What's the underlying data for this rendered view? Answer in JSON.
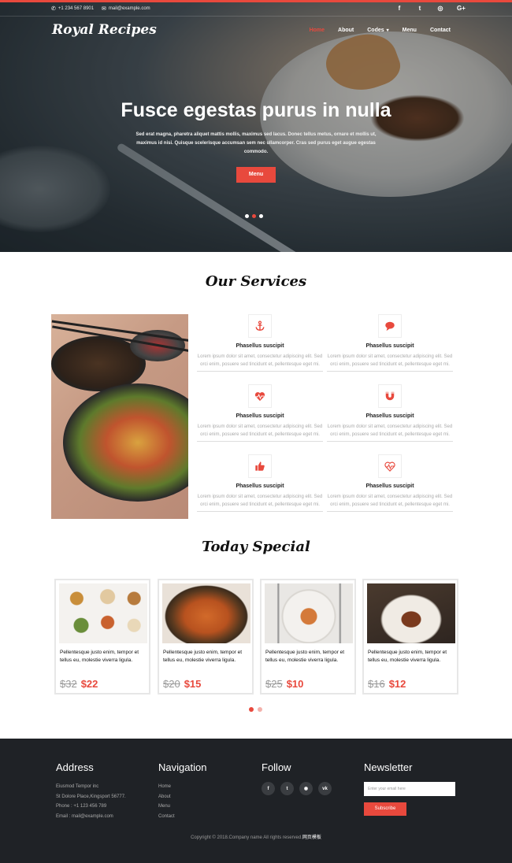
{
  "colors": {
    "accent": "#e8493d",
    "footer_bg": "#1f2226"
  },
  "topbar": {
    "phone": "+1 234 567 8901",
    "email": "mail@example.com",
    "social_icons": [
      "facebook-icon",
      "twitter-icon",
      "dribbble-icon",
      "google-plus-icon"
    ]
  },
  "header": {
    "logo": "Royal Recipes",
    "nav": [
      {
        "label": "Home",
        "active": true
      },
      {
        "label": "About"
      },
      {
        "label": "Codes",
        "dropdown": true
      },
      {
        "label": "Menu"
      },
      {
        "label": "Contact"
      }
    ]
  },
  "hero": {
    "title": "Fusce egestas purus in nulla",
    "text": "Sed erat magna, pharetra aliquet mattis mollis, maximus sed lacus. Donec tellus metus, ornare et mollis ut, maximus id nisi. Quisque scelerisque accumsan sem nec ullamcorper. Cras sed purus eget augue egestas commodo.",
    "button": "Menu"
  },
  "services": {
    "title": "Our Services",
    "items": [
      {
        "icon": "anchor-icon",
        "title": "Phasellus suscipit",
        "text": "Lorem ipsum dolor sit amet, consectetur adipiscing elit. Sed orci enim, posuere sed tincidunt et, pellentesque eget mi."
      },
      {
        "icon": "chat-icon",
        "title": "Phasellus suscipit",
        "text": "Lorem ipsum dolor sit amet, consectetur adipiscing elit. Sed orci enim, posuere sed tincidunt et, pellentesque eget mi."
      },
      {
        "icon": "heartbeat-icon",
        "title": "Phasellus suscipit",
        "text": "Lorem ipsum dolor sit amet, consectetur adipiscing elit. Sed orci enim, posuere sed tincidunt et, pellentesque eget mi."
      },
      {
        "icon": "magnet-icon",
        "title": "Phasellus suscipit",
        "text": "Lorem ipsum dolor sit amet, consectetur adipiscing elit. Sed orci enim, posuere sed tincidunt et, pellentesque eget mi."
      },
      {
        "icon": "thumbs-up-icon",
        "title": "Phasellus suscipit",
        "text": "Lorem ipsum dolor sit amet, consectetur adipiscing elit. Sed orci enim, posuere sed tincidunt et, pellentesque eget mi."
      },
      {
        "icon": "heartbeat-icon",
        "title": "Phasellus suscipit",
        "text": "Lorem ipsum dolor sit amet, consectetur adipiscing elit. Sed orci enim, posuere sed tincidunt et, pellentesque eget mi."
      }
    ]
  },
  "special": {
    "title": "Today Special",
    "items": [
      {
        "text": "Pellentesque justo enim, tempor et tellus eu, molestie viverra ligula.",
        "old_price": "$32",
        "new_price": "$22"
      },
      {
        "text": "Pellentesque justo enim, tempor et tellus eu, molestie viverra ligula.",
        "old_price": "$20",
        "new_price": "$15"
      },
      {
        "text": "Pellentesque justo enim, tempor et tellus eu, molestie viverra ligula.",
        "old_price": "$25",
        "new_price": "$10"
      },
      {
        "text": "Pellentesque justo enim, tempor et tellus eu, molestie viverra ligula.",
        "old_price": "$16",
        "new_price": "$12"
      }
    ]
  },
  "footer": {
    "address": {
      "title": "Address",
      "lines": [
        "Eiusmod Tempor inc",
        "St Dolore Place,Kingsport 56777.",
        "Phone : +1 123 456 789",
        "Email : mail@example.com"
      ]
    },
    "navigation": {
      "title": "Navigation",
      "links": [
        "Home",
        "About",
        "Menu",
        "Contact"
      ]
    },
    "follow": {
      "title": "Follow",
      "icons": [
        "facebook-icon",
        "twitter-icon",
        "rss-icon",
        "vk-icon"
      ]
    },
    "newsletter": {
      "title": "Newsletter",
      "placeholder": "Enter your email here",
      "button": "Subscribe"
    },
    "copyright": "Copyright © 2018.Company name All rights reserved.",
    "copyright_link": "网页模板"
  }
}
